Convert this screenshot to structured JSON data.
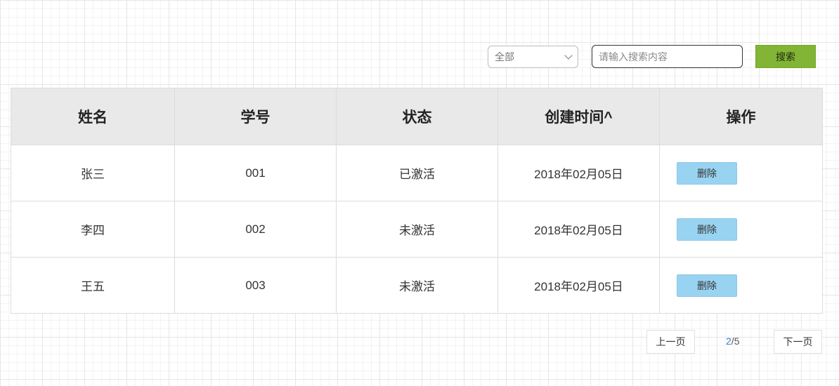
{
  "filter": {
    "select_value": "全部",
    "search_placeholder": "请输入搜索内容",
    "search_button": "搜索"
  },
  "table": {
    "headers": [
      "姓名",
      "学号",
      "状态",
      "创建时间^",
      "操作"
    ],
    "rows": [
      {
        "name": "张三",
        "id": "001",
        "status": "已激活",
        "created": "2018年02月05日",
        "action": "删除"
      },
      {
        "name": "李四",
        "id": "002",
        "status": "未激活",
        "created": "2018年02月05日",
        "action": "删除"
      },
      {
        "name": "王五",
        "id": "003",
        "status": "未激活",
        "created": "2018年02月05日",
        "action": "删除"
      }
    ]
  },
  "pagination": {
    "prev_label": "上一页",
    "current_page": "2",
    "separator": "/",
    "total_pages": "5",
    "next_label": "下一页"
  },
  "colors": {
    "search_button": "#82b435",
    "delete_button": "#99d3f2",
    "current_page": "#2f7fd6",
    "header_bg": "#e9e9e9"
  }
}
